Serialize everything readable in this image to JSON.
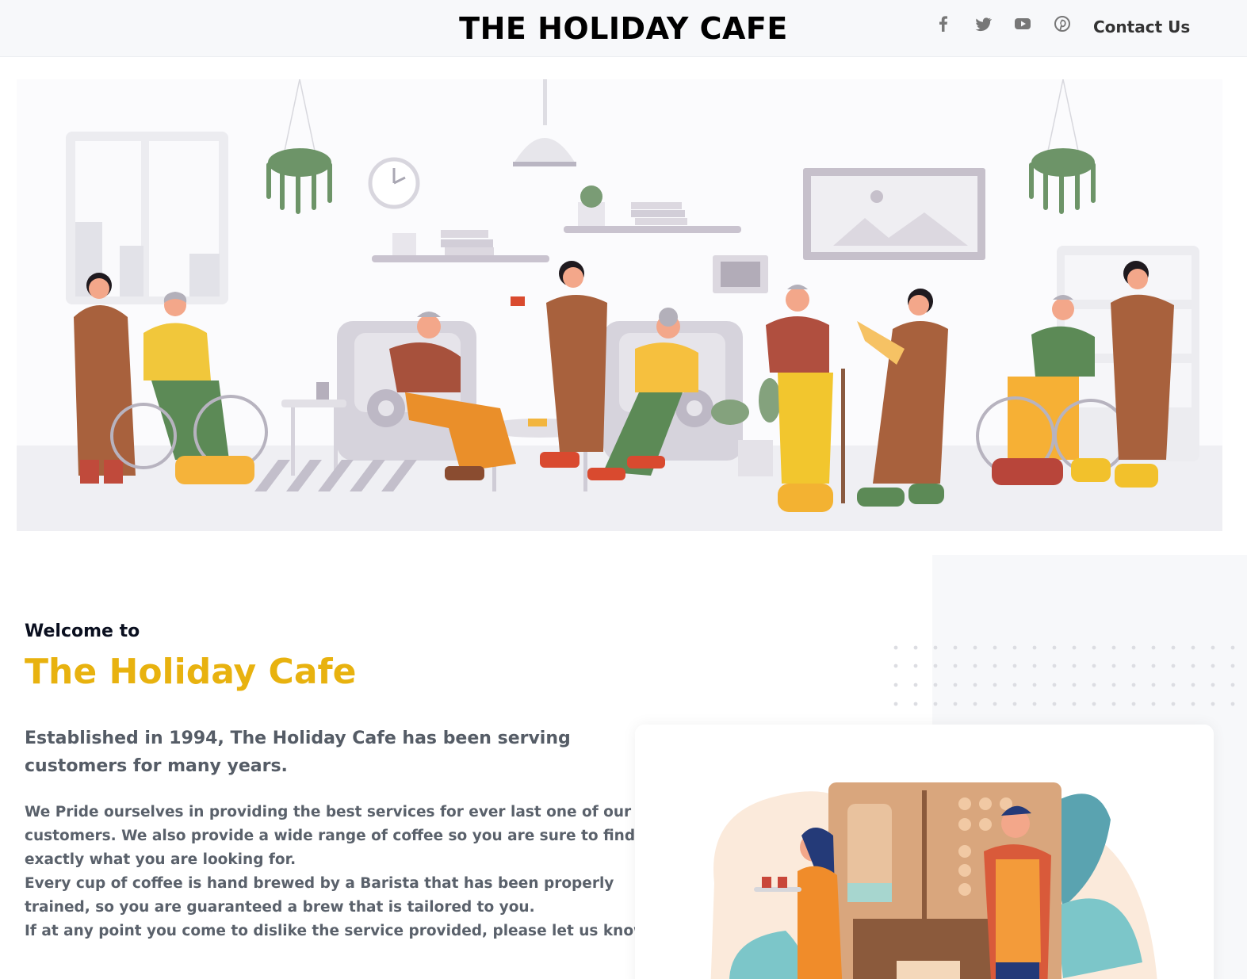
{
  "header": {
    "brand": "THE HOLIDAY CAFE",
    "social": [
      {
        "icon": "facebook-icon"
      },
      {
        "icon": "twitter-icon"
      },
      {
        "icon": "youtube-icon"
      },
      {
        "icon": "pinterest-icon"
      }
    ],
    "contact_label": "Contact Us"
  },
  "intro": {
    "welcome": "Welcome to",
    "name": "The Holiday Cafe",
    "lead": "Established in 1994, The Holiday Cafe has been serving customers for many years.",
    "paragraphs": [
      "We Pride ourselves in providing the best services for ever last one of our",
      "customers. We also provide a wide range of coffee so you are sure to find",
      "exactly what you are looking for.",
      "Every cup of coffee is hand brewed by a Barista that has been properly",
      "trained, so you are guaranteed a brew that is tailored to you.",
      "If at any point you come to dislike the service provided, please let us know."
    ]
  },
  "colors": {
    "accent": "#e8b20f",
    "header_bg": "#f7f8fa",
    "heading": "#0a0f1f",
    "body_text": "#5a616b"
  }
}
